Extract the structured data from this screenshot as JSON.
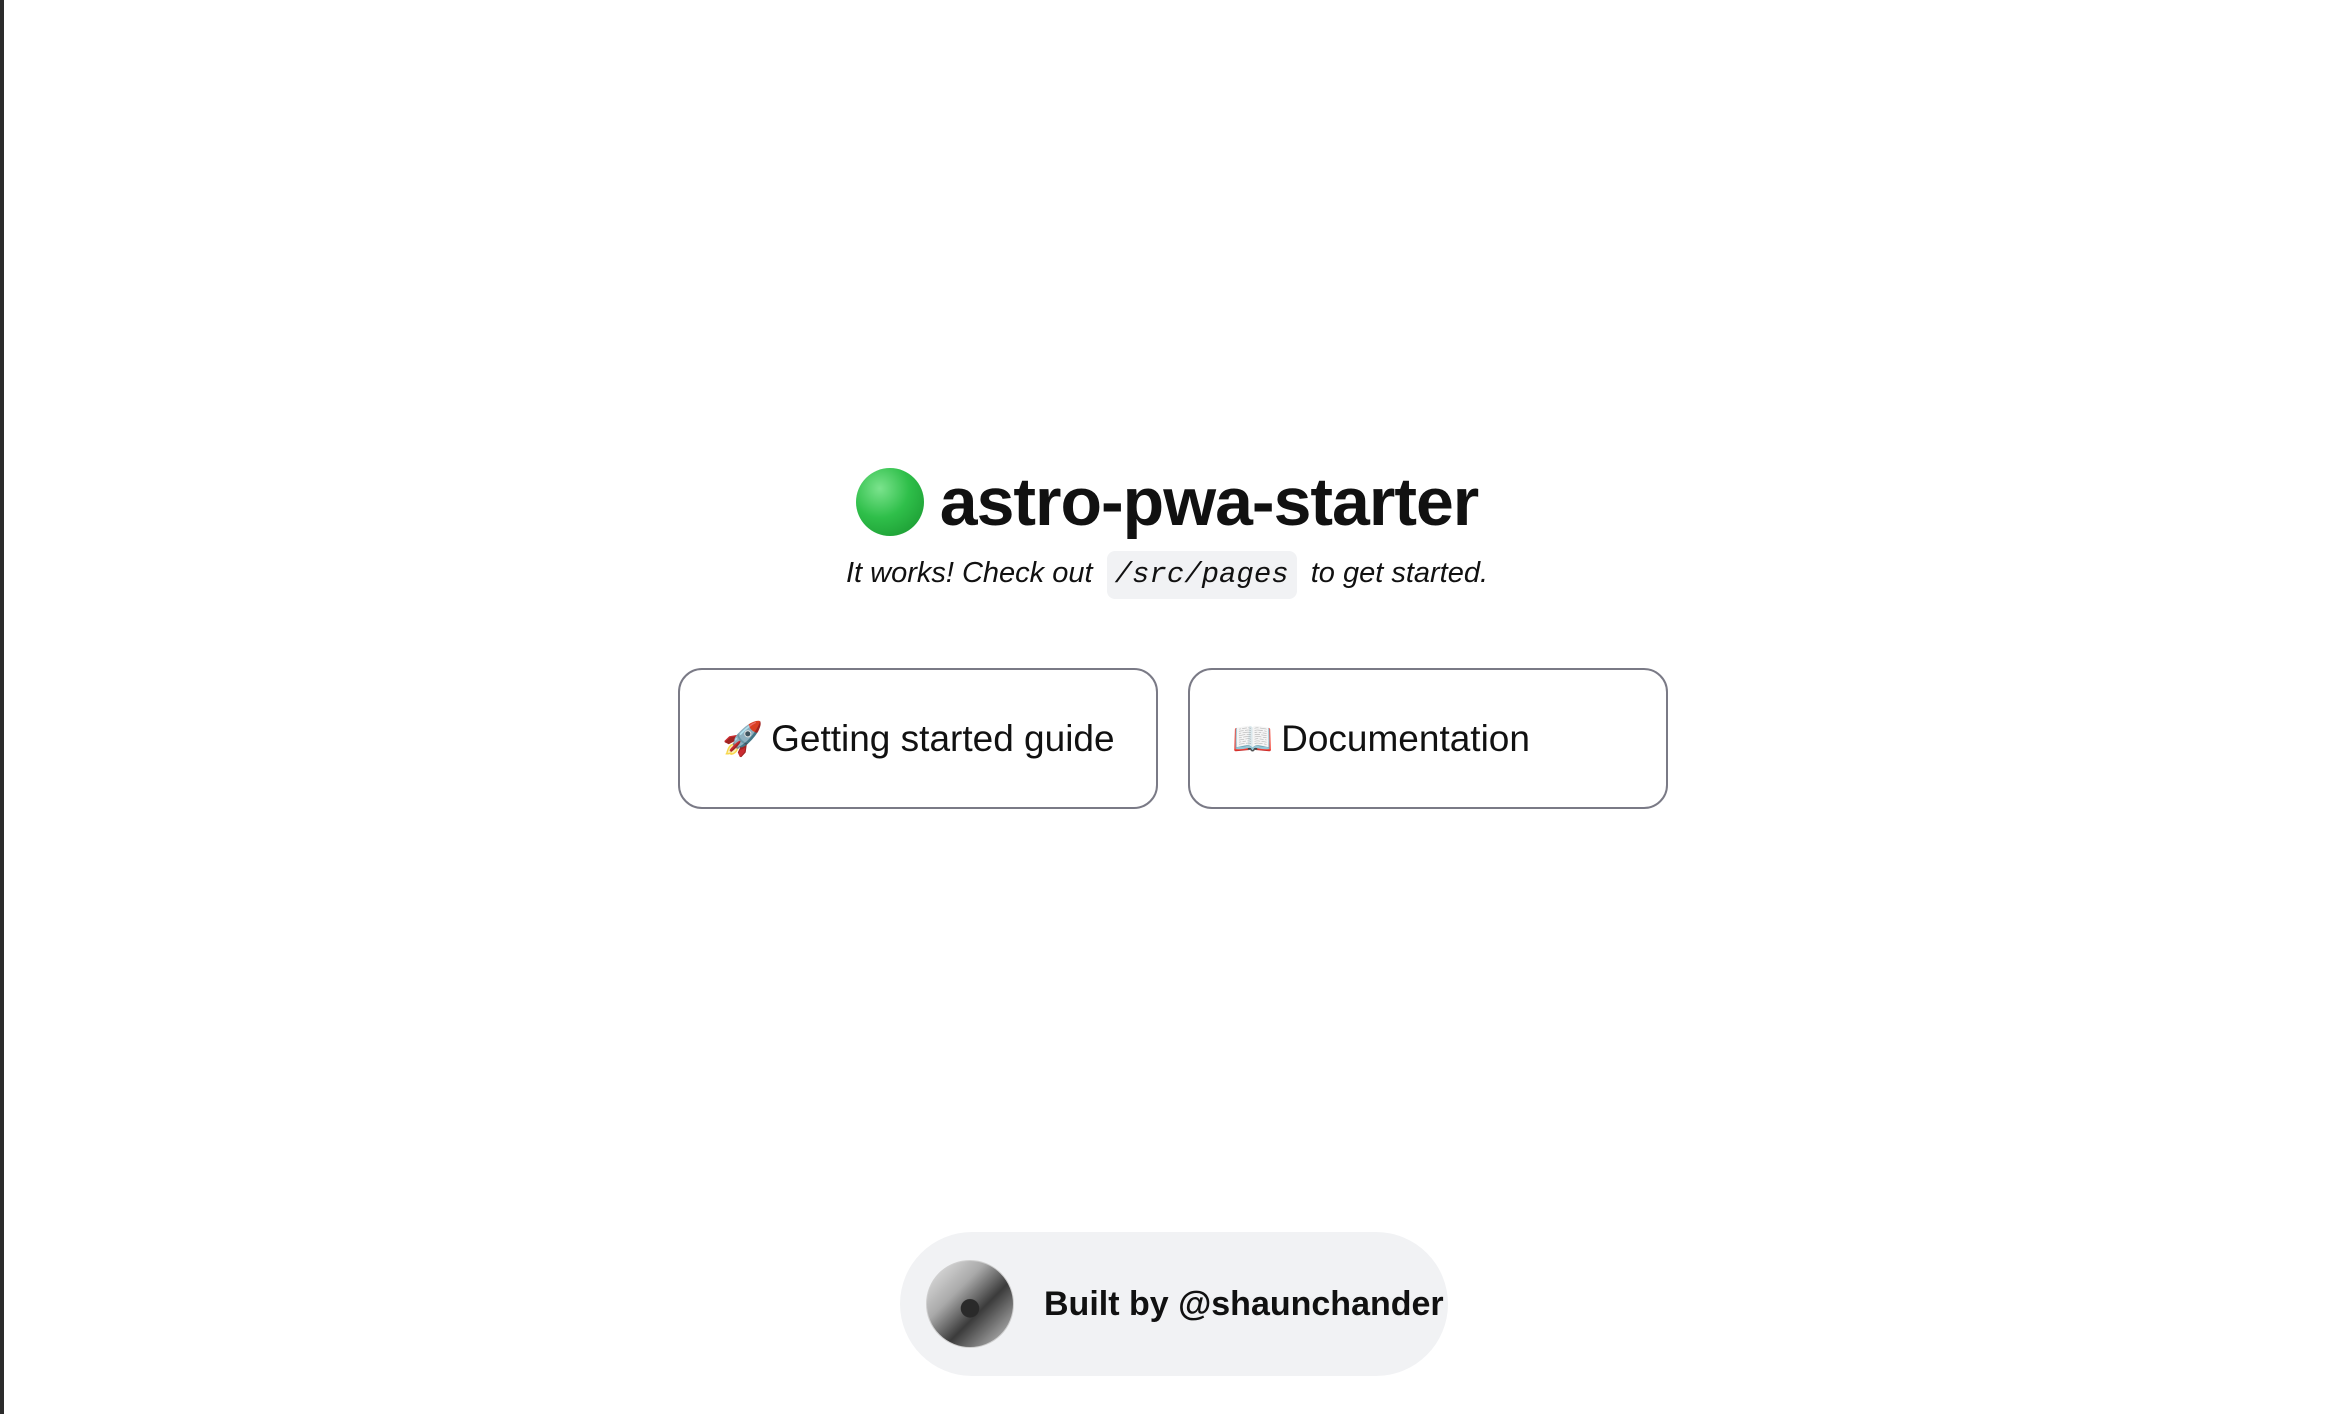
{
  "hero": {
    "title": "astro-pwa-starter",
    "subtitle_before": "It works! Check out",
    "subtitle_code": "/src/pages",
    "subtitle_after": "to get started."
  },
  "cards": [
    {
      "icon": "rocket-icon",
      "glyph": "🚀",
      "label": "Getting started guide"
    },
    {
      "icon": "book-icon",
      "glyph": "📖",
      "label": "Documentation"
    }
  ],
  "footer": {
    "label": "Built by @shaunchander"
  }
}
